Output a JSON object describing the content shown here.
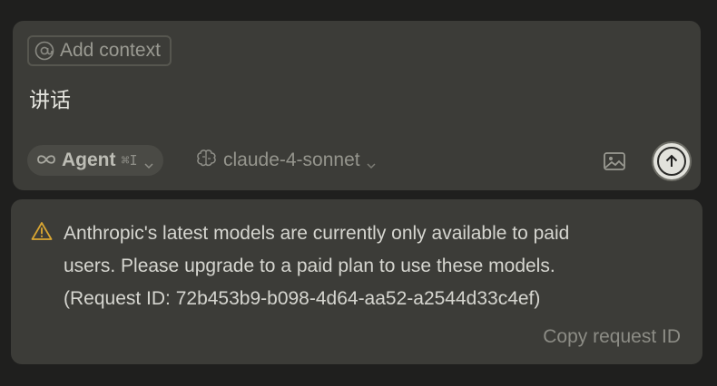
{
  "composer": {
    "context_button_label": "Add context",
    "message_text": "讲话",
    "mode": {
      "label": "Agent",
      "shortcut": "⌘I"
    },
    "model": {
      "label": "claude-4-sonnet"
    }
  },
  "error": {
    "lines": [
      "Anthropic's latest models are currently only available to paid",
      "users. Please upgrade to a paid plan to use these models.",
      "(Request ID: 72b453b9-b098-4d64-aa52-a2544d33c4ef)"
    ],
    "copy_label": "Copy request ID"
  },
  "colors": {
    "background": "#1f1f1e",
    "panel": "#3c3c38",
    "warning": "#d9a632"
  }
}
